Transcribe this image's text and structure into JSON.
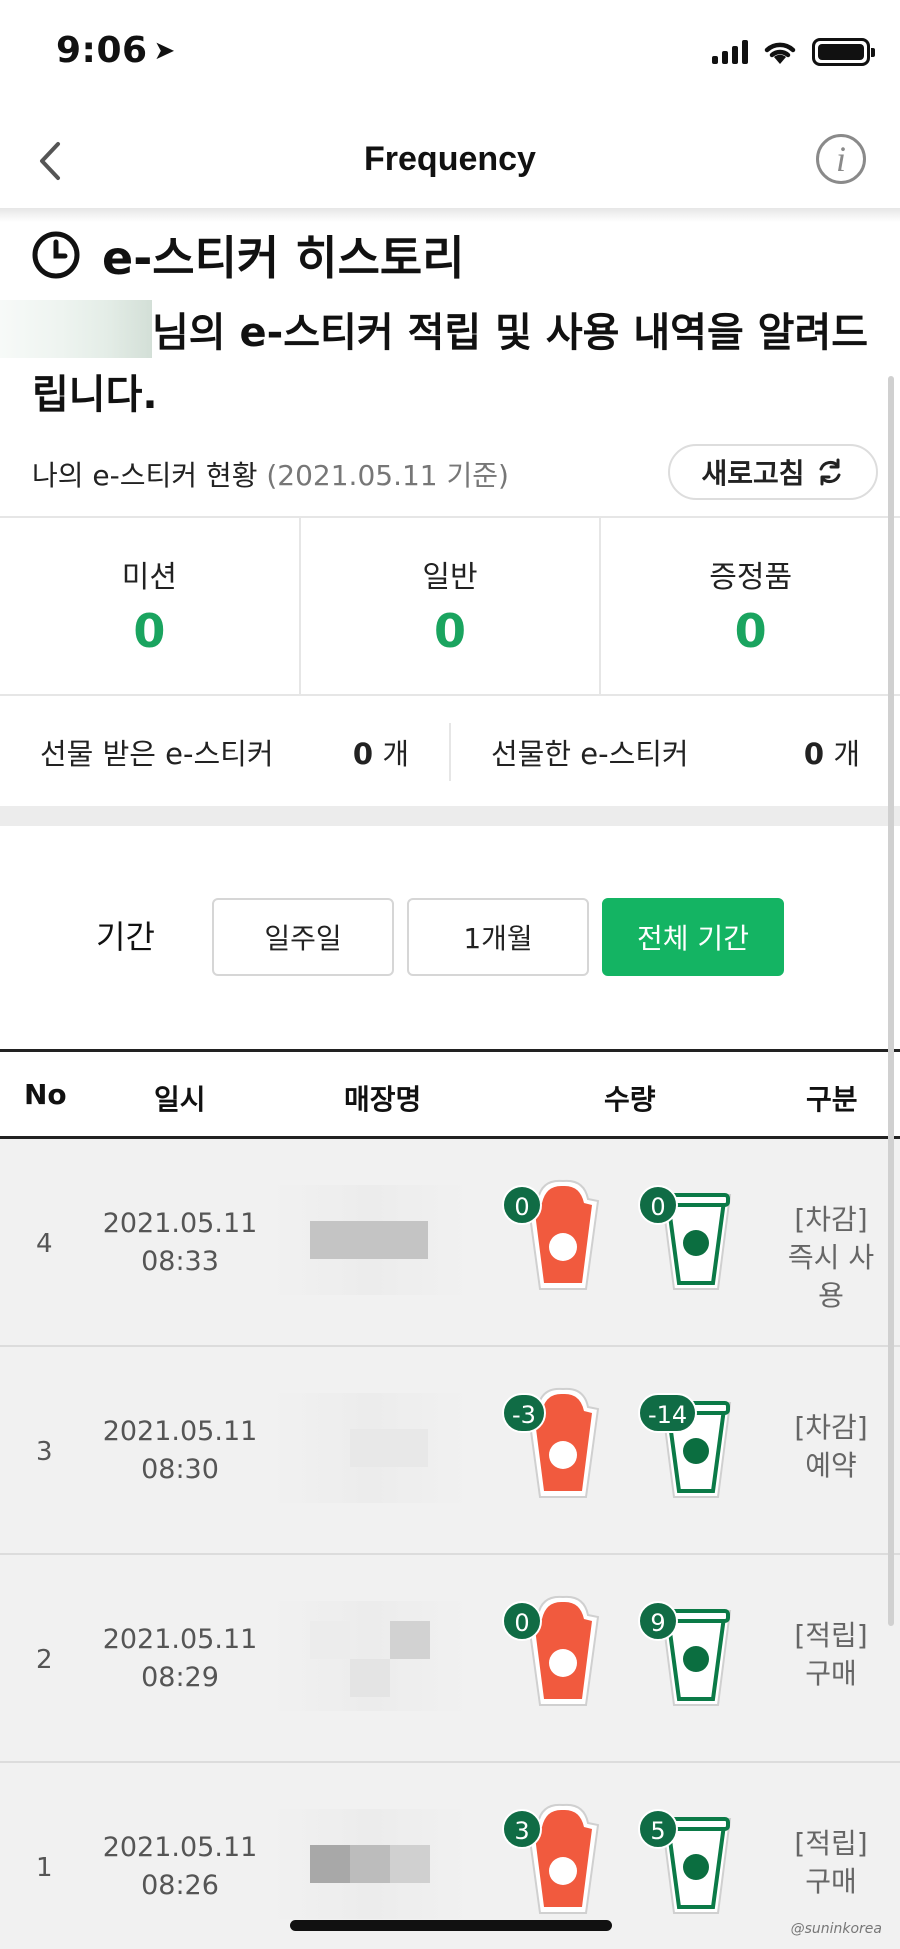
{
  "status_bar": {
    "time": "9:06"
  },
  "nav": {
    "title": "Frequency",
    "info_glyph": "i"
  },
  "history": {
    "title": "e-스티커 히스토리",
    "desc_line1": "님의 e-스티커 적립 및 사용 내역을 알려드",
    "desc_line2": "립니다.",
    "status_label": "나의 e-스티커 현황",
    "status_date": "(2021.05.11 기준)",
    "refresh_label": "새로고침"
  },
  "counts": [
    {
      "label": "미션",
      "value": "0"
    },
    {
      "label": "일반",
      "value": "0"
    },
    {
      "label": "증정품",
      "value": "0"
    }
  ],
  "gifts": {
    "received_label": "선물 받은 e-스티커",
    "received_count": "0",
    "sent_label": "선물한 e-스티커",
    "sent_count": "0",
    "unit": "개"
  },
  "period": {
    "label": "기간",
    "options": [
      "일주일",
      "1개월",
      "전체 기간"
    ],
    "selected": "전체 기간"
  },
  "table": {
    "headers": [
      "No",
      "일시",
      "매장명",
      "수량",
      "구분"
    ],
    "rows": [
      {
        "no": "4",
        "date": "2021.05.11",
        "time": "08:33",
        "red_qty": "0",
        "green_qty": "0",
        "type_line1": "[차감]",
        "type_line2": "즉시 사용"
      },
      {
        "no": "3",
        "date": "2021.05.11",
        "time": "08:30",
        "red_qty": "-3",
        "green_qty": "-14",
        "type_line1": "[차감]",
        "type_line2": "예약"
      },
      {
        "no": "2",
        "date": "2021.05.11",
        "time": "08:29",
        "red_qty": "0",
        "green_qty": "9",
        "type_line1": "[적립]",
        "type_line2": "구매"
      },
      {
        "no": "1",
        "date": "2021.05.11",
        "time": "08:26",
        "red_qty": "3",
        "green_qty": "5",
        "type_line1": "[적립]",
        "type_line2": "구매"
      }
    ]
  },
  "watermark": "@suninkorea",
  "colors": {
    "accent_green": "#14b463",
    "count_green": "#1aa45f",
    "badge_green": "#106c45",
    "red_cup": "#f15a3e"
  }
}
